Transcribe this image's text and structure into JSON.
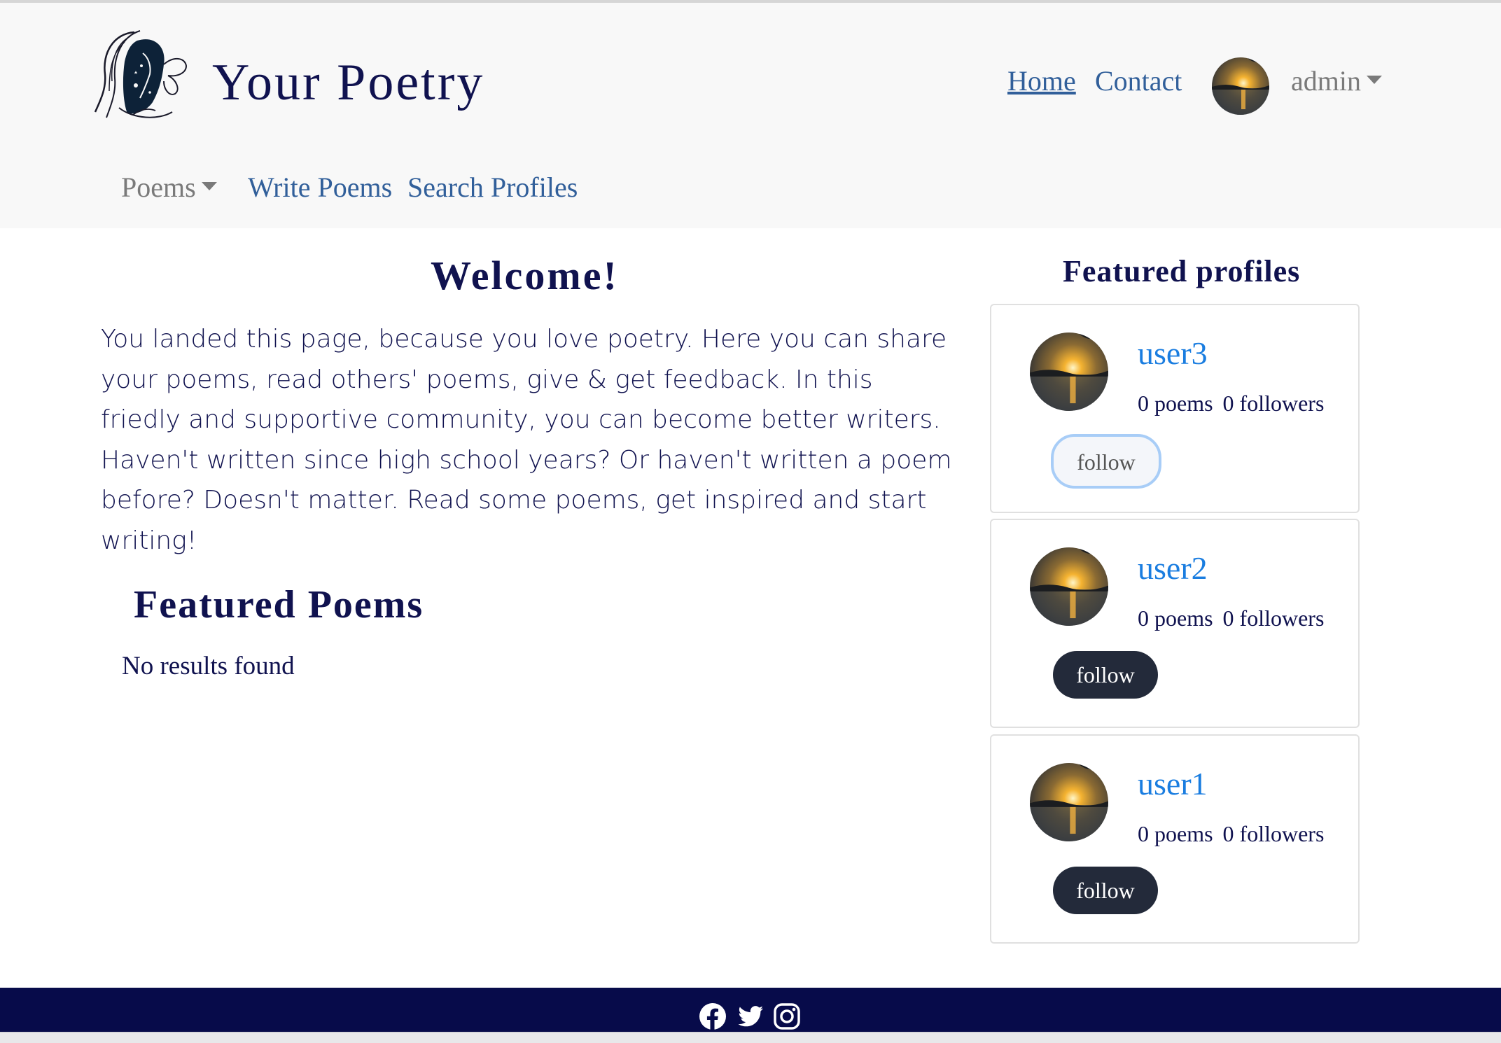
{
  "brand": {
    "title": "Your Poetry"
  },
  "nav": {
    "home_label": "Home",
    "contact_label": "Contact",
    "user_label": "admin",
    "poems_label": "Poems",
    "write_label": "Write Poems",
    "search_label": "Search Profiles"
  },
  "main": {
    "welcome_title": "Welcome!",
    "intro": "You landed this page, because you love poetry. Here you can share your poems, read others' poems, give & get feedback. In this friedly and supportive community, you can become better writers. Haven't written since high school years? Or haven't written a poem before? Doesn't matter. Read some poems, get inspired and start writing!",
    "featured_poems_title": "Featured Poems",
    "no_results": "No results found"
  },
  "sidebar": {
    "title": "Featured profiles",
    "profiles": [
      {
        "name": "user3",
        "poems": "0 poems",
        "followers": "0 followers",
        "button": "follow",
        "button_state": "focused"
      },
      {
        "name": "user2",
        "poems": "0 poems",
        "followers": "0 followers",
        "button": "follow",
        "button_state": "default"
      },
      {
        "name": "user1",
        "poems": "0 poems",
        "followers": "0 followers",
        "button": "follow",
        "button_state": "default"
      }
    ]
  },
  "footer": {
    "icons": [
      "facebook-icon",
      "twitter-icon",
      "instagram-icon"
    ]
  },
  "colors": {
    "navy": "#10124f",
    "link": "#315f9a",
    "profile_link": "#1a7de0",
    "footer_bg": "#070b4a",
    "dark_button": "#232a3a"
  }
}
